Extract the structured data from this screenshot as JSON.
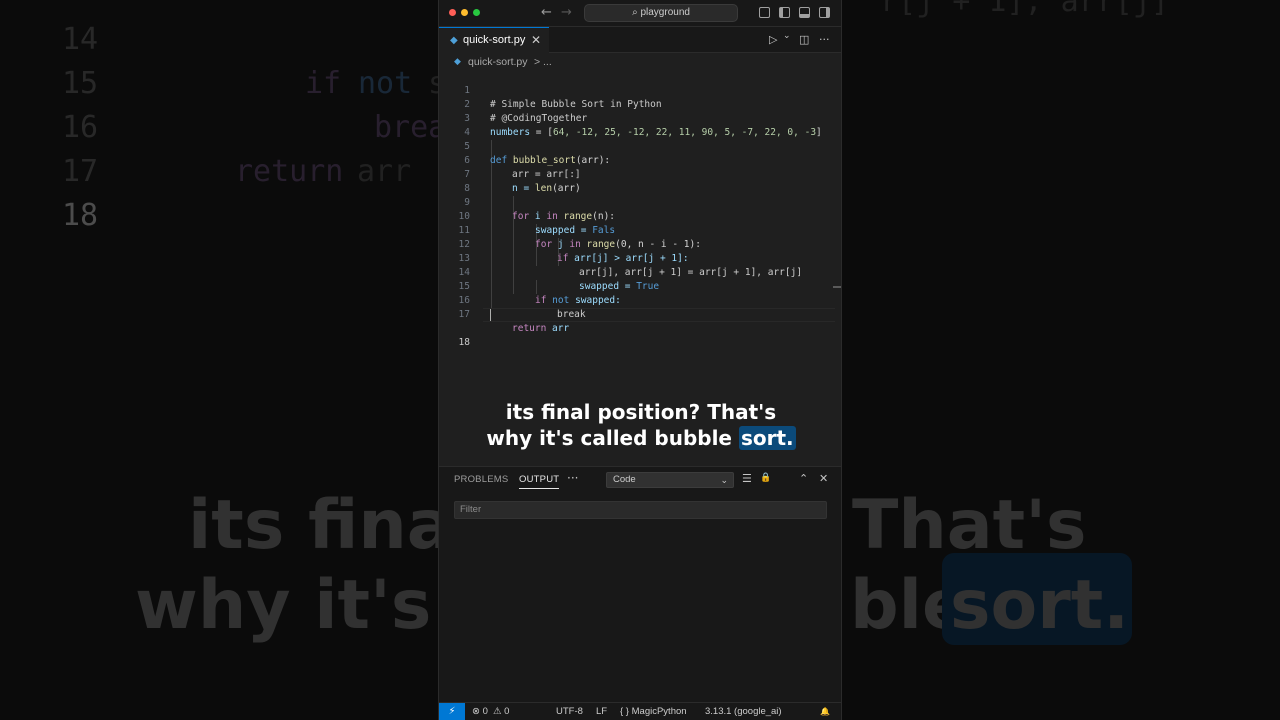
{
  "background": {
    "line_numbers": [
      "14",
      "15",
      "16",
      "17",
      "18"
    ],
    "code": {
      "top_fragment": "r[j + 1], arr[j]",
      "l15_kw": "if",
      "l15_kw2": "not",
      "l15_rest": "s",
      "l16": "brea",
      "l17_kw": "return",
      "l17_rest": "arr"
    },
    "caption": {
      "line1_left": "its fina",
      "line1_right": "That's",
      "line2_left": "why it's",
      "line2_mid": "ble",
      "line2_highlight": "sort."
    }
  },
  "titlebar": {
    "back_icon": "←",
    "forward_icon": "→",
    "search_icon": "⌕",
    "search_text": "playground"
  },
  "tabs": [
    {
      "label": "quick-sort.py",
      "close": "✕",
      "icon": "◆"
    }
  ],
  "tab_actions": {
    "run": "▷",
    "run_menu": "⌄",
    "split": "◫",
    "more": "···"
  },
  "breadcrumb": {
    "file": "quick-sort.py",
    "sep": ">",
    "rest": "..."
  },
  "editor": {
    "line_numbers": [
      "1",
      "2",
      "3",
      "4",
      "5",
      "6",
      "7",
      "8",
      "9",
      "10",
      "11",
      "12",
      "13",
      "14",
      "15",
      "16",
      "17",
      "18"
    ],
    "lines": {
      "l1": "# Simple Bubble Sort in Python",
      "l2": "# @CodingTogether",
      "l3_var": "numbers",
      "l3_eq": " = [",
      "l3_vals": "64, -12, 25, -12, 22, 11, 90, 5, -7, 22, 0, -3",
      "l3_end": "]",
      "l5_def": "def",
      "l5_fn": " bubble_sort",
      "l5_rest": "(arr):",
      "l6": "arr = arr[:]",
      "l7_a": "n = ",
      "l7_fn": "len",
      "l7_b": "(arr)",
      "l9_for": "for",
      "l9_i": " i ",
      "l9_in": "in",
      "l9_fn": " range",
      "l9_rest": "(n):",
      "l10_a": "swapped = ",
      "l10_b": "Fals",
      "l11_for": "for",
      "l11_j": " j ",
      "l11_in": "in",
      "l11_fn": " range",
      "l11_rest": "(0, n - i - 1):",
      "l12_if": "if",
      "l12_rest": " arr[j] > arr[j + 1]:",
      "l13": "arr[j], arr[j + 1] = arr[j + 1], arr[j]",
      "l14_a": "swapped = ",
      "l14_b": "True",
      "l15_if": "if",
      "l15_not": " not",
      "l15_rest": " swapped:",
      "l16": "break",
      "l17_ret": "return",
      "l17_rest": " arr"
    }
  },
  "caption": {
    "line1": "its final position? That's",
    "line2_pre": "why it's called bubble ",
    "line2_highlight": "sort."
  },
  "panel": {
    "tabs": [
      "PROBLEMS",
      "OUTPUT"
    ],
    "active_tab": "OUTPUT",
    "more": "···",
    "channel_select": "Code",
    "chevron": "⌄",
    "icons": {
      "list": "☰",
      "lock": "🔒",
      "maximize": "⌃",
      "close": "✕"
    },
    "filter_placeholder": "Filter"
  },
  "status_bar": {
    "remote_icon": "⚡",
    "errors": "⊗ 0",
    "warnings": "⚠ 0",
    "encoding": "UTF-8",
    "eol": "LF",
    "language": "{ } MagicPython",
    "interpreter": "3.13.1 (google_ai)",
    "bell_icon": "🔔"
  },
  "colors": {
    "accent": "#0078d4",
    "editor_bg": "#1f1f1f",
    "chrome_bg": "#181818",
    "caption_highlight": "#0b4a7a"
  }
}
